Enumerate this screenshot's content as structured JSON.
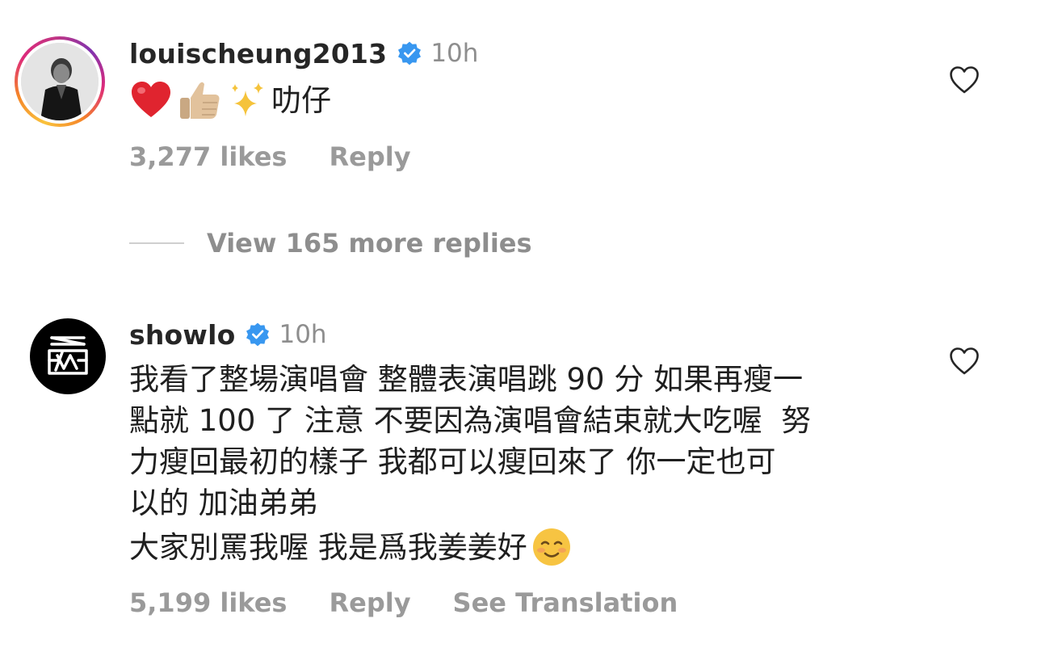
{
  "comments": [
    {
      "username": "louischeung2013",
      "time": "10h",
      "text": "叻仔",
      "likes": "3,277 likes",
      "reply": "Reply",
      "emoji_names": [
        "red-heart",
        "thumbs-up",
        "sparkles"
      ]
    },
    {
      "username": "showlo",
      "time": "10h",
      "text": "我看了整場演唱會 整體表演唱跳 90 分 如果再瘦一\n點就 100 了 注意 不要因為演唱會結束就大吃喔  努\n力瘦回最初的樣子 我都可以瘦回來了 你一定也可\n以的 加油弟弟",
      "text2": "大家別罵我喔 我是爲我姜姜好",
      "likes": "5,199 likes",
      "reply": "Reply",
      "see_translation": "See Translation",
      "emoji_names": [
        "smiling-face"
      ]
    }
  ],
  "view_more": "View 165 more replies",
  "colors": {
    "muted": "#9a9a9a",
    "verified": "#3897f0",
    "text": "#1f1f1f"
  }
}
